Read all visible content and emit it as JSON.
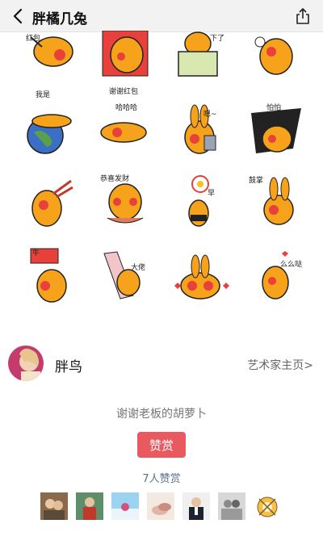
{
  "nav": {
    "title": "胖橘几兔",
    "back_icon": "chevron-left-icon",
    "share_icon": "share-icon"
  },
  "stickers": [
    {
      "caption": "红包"
    },
    {
      "caption": "谢谢红包"
    },
    {
      "caption": "下了"
    },
    {
      "caption": ""
    },
    {
      "caption": "我是"
    },
    {
      "caption": "哈哈哈"
    },
    {
      "caption": "嗯~"
    },
    {
      "caption": "怕怕"
    },
    {
      "caption": ""
    },
    {
      "caption": "恭喜发财"
    },
    {
      "caption": "早"
    },
    {
      "caption": "鼓掌"
    },
    {
      "caption": "牛"
    },
    {
      "caption": "大佬"
    },
    {
      "caption": ""
    },
    {
      "caption": "么么哒"
    }
  ],
  "artist": {
    "name": "胖鸟",
    "link_label": "艺术家主页>"
  },
  "thanks_text": "谢谢老板的胡萝卜",
  "reward_button": "赞赏",
  "reward_count": "7人赞赏",
  "colors": {
    "accent": "#e85a5f",
    "rabbit_orange": "#f7a21b",
    "cheek_red": "#e8403a",
    "link_blue": "#5c6f8f"
  }
}
